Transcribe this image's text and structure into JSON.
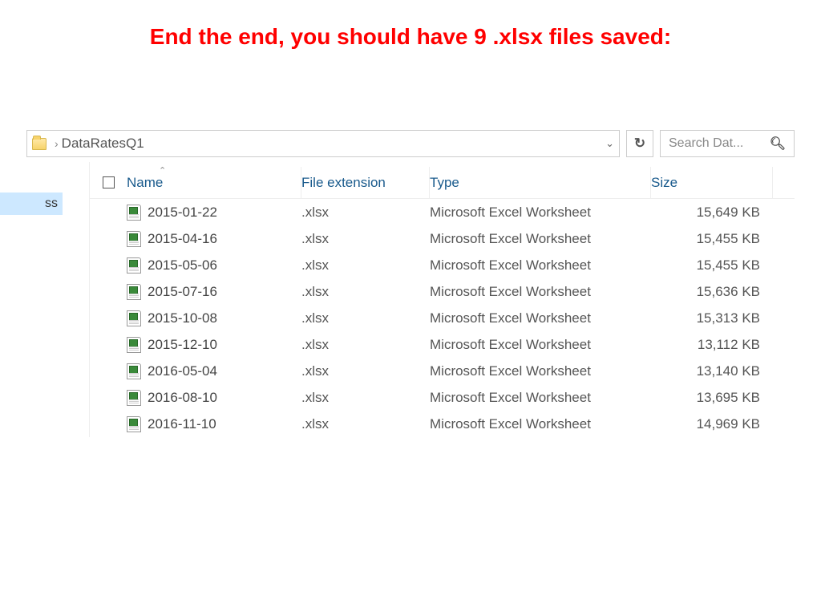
{
  "title": "End the end, you should have 9 .xlsx files saved:",
  "breadcrumb": {
    "folder": "DataRatesQ1"
  },
  "search": {
    "placeholder": "Search Dat..."
  },
  "nav": {
    "selected_fragment": "ss"
  },
  "columns": {
    "name": "Name",
    "ext": "File extension",
    "type": "Type",
    "size": "Size"
  },
  "files": [
    {
      "name": "2015-01-22",
      "ext": ".xlsx",
      "type": "Microsoft Excel Worksheet",
      "size": "15,649 KB"
    },
    {
      "name": "2015-04-16",
      "ext": ".xlsx",
      "type": "Microsoft Excel Worksheet",
      "size": "15,455 KB"
    },
    {
      "name": "2015-05-06",
      "ext": ".xlsx",
      "type": "Microsoft Excel Worksheet",
      "size": "15,455 KB"
    },
    {
      "name": "2015-07-16",
      "ext": ".xlsx",
      "type": "Microsoft Excel Worksheet",
      "size": "15,636 KB"
    },
    {
      "name": "2015-10-08",
      "ext": ".xlsx",
      "type": "Microsoft Excel Worksheet",
      "size": "15,313 KB"
    },
    {
      "name": "2015-12-10",
      "ext": ".xlsx",
      "type": "Microsoft Excel Worksheet",
      "size": "13,112 KB"
    },
    {
      "name": "2016-05-04",
      "ext": ".xlsx",
      "type": "Microsoft Excel Worksheet",
      "size": "13,140 KB"
    },
    {
      "name": "2016-08-10",
      "ext": ".xlsx",
      "type": "Microsoft Excel Worksheet",
      "size": "13,695 KB"
    },
    {
      "name": "2016-11-10",
      "ext": ".xlsx",
      "type": "Microsoft Excel Worksheet",
      "size": "14,969 KB"
    }
  ]
}
